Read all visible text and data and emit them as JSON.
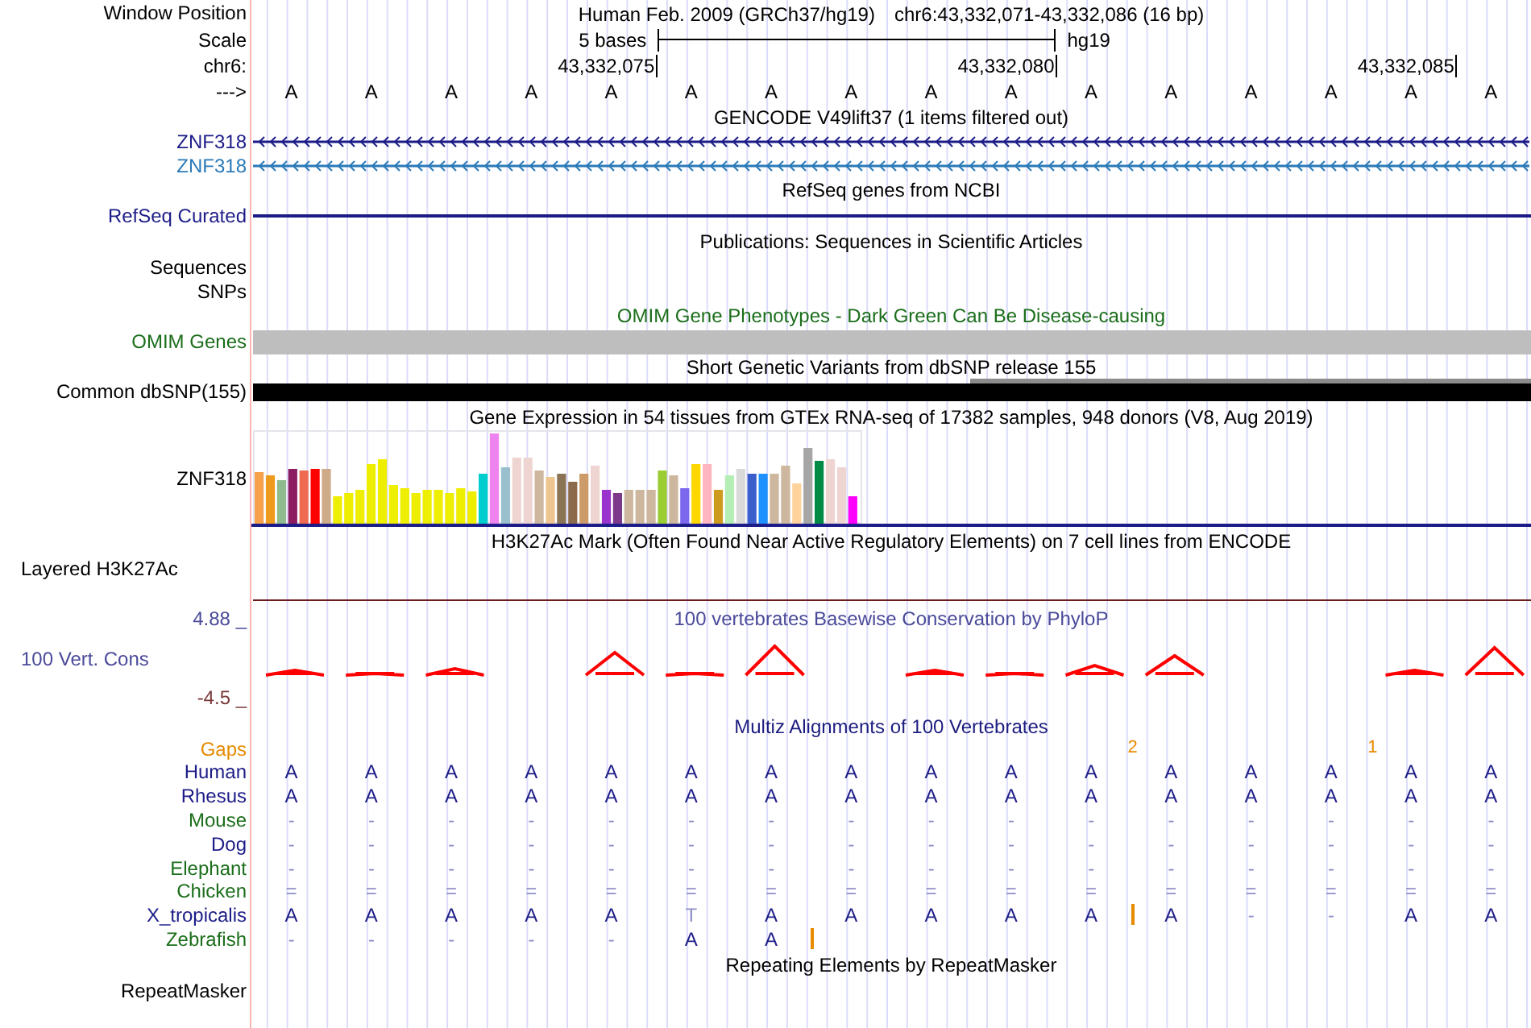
{
  "header": {
    "label": "Window Position",
    "assembly": "Human Feb. 2009 (GRCh37/hg19)",
    "position": "chr6:43,332,071-43,332,086 (16 bp)"
  },
  "scale": {
    "label": "Scale",
    "span": "5 bases",
    "assembly": "hg19"
  },
  "coordinates": {
    "label": "chr6:",
    "ticks": [
      "43,332,075",
      "43,332,080",
      "43,332,085"
    ]
  },
  "sequence": {
    "label": "--->",
    "bases": [
      "A",
      "A",
      "A",
      "A",
      "A",
      "A",
      "A",
      "A",
      "A",
      "A",
      "A",
      "A",
      "A",
      "A",
      "A",
      "A"
    ]
  },
  "tracks": [
    {
      "kind": "gene",
      "title": "GENCODE V49lift37 (1 items filtered out)",
      "rows": [
        {
          "label": "ZNF318",
          "color": "#1c1c88"
        },
        {
          "label": "ZNF318",
          "color": "#2a7ab8"
        }
      ]
    },
    {
      "kind": "line",
      "title": "RefSeq genes from NCBI",
      "label": "RefSeq Curated",
      "color": "#1c1c88"
    },
    {
      "kind": "empty",
      "title": "Publications: Sequences in Scientific Articles",
      "labels": [
        "Sequences",
        "SNPs"
      ],
      "color": "#000000"
    },
    {
      "kind": "bar",
      "title": "OMIM Gene Phenotypes - Dark Green Can Be Disease-causing",
      "label": "OMIM Genes",
      "color": "#1b6e1b"
    },
    {
      "kind": "variants",
      "title": "Short Genetic Variants from dbSNP release 155",
      "label": "Common dbSNP(155)",
      "color": "#000000"
    },
    {
      "kind": "expression",
      "title": "Gene Expression in 54 tissues from GTEx RNA-seq of 17382 samples, 948 donors (V8, Aug 2019)",
      "label": "ZNF318",
      "color": "#000000"
    },
    {
      "kind": "layered",
      "title": "H3K27Ac Mark (Often Found Near Active Regulatory Elements) on 7 cell lines from ENCODE",
      "label": "Layered H3K27Ac",
      "color": "#000000"
    },
    {
      "kind": "conservation",
      "title": "100 vertebrates Basewise Conservation by PhyloP",
      "label": "100 Vert. Cons",
      "max": "4.88 _",
      "min": "-4.5 _",
      "color": "#4a4a9a"
    },
    {
      "kind": "alignment",
      "title": "Multiz Alignments of 100 Vertebrates",
      "color": "#1c1c80",
      "gaps": {
        "label": "Gaps",
        "columns": [
          {
            "gap": false
          },
          {
            "gap": false
          },
          {
            "gap": false
          },
          {
            "gap": false
          },
          {
            "gap": false
          },
          {
            "gap": false
          },
          {
            "gap": false
          },
          {
            "gap": false
          },
          {
            "gap": false
          },
          {
            "gap": false
          },
          {
            "gap": true,
            "count": "2"
          },
          {
            "gap": false
          },
          {
            "gap": false
          },
          {
            "gap": true,
            "count": "1"
          },
          {
            "gap": false
          },
          {
            "gap": false
          }
        ]
      },
      "species": [
        {
          "label": "Human",
          "color": "#1c1c88",
          "cells": [
            {
              "text": "A",
              "match": true,
              "insertion": false
            },
            {
              "text": "A",
              "match": true,
              "insertion": false
            },
            {
              "text": "A",
              "match": true,
              "insertion": false
            },
            {
              "text": "A",
              "match": true,
              "insertion": false
            },
            {
              "text": "A",
              "match": true,
              "insertion": false
            },
            {
              "text": "A",
              "match": true,
              "insertion": false
            },
            {
              "text": "A",
              "match": true,
              "insertion": false
            },
            {
              "text": "A",
              "match": true,
              "insertion": false
            },
            {
              "text": "A",
              "match": true,
              "insertion": false
            },
            {
              "text": "A",
              "match": true,
              "insertion": false
            },
            {
              "text": "A",
              "match": true,
              "insertion": false
            },
            {
              "text": "A",
              "match": true,
              "insertion": false
            },
            {
              "text": "A",
              "match": true,
              "insertion": false
            },
            {
              "text": "A",
              "match": true,
              "insertion": false
            },
            {
              "text": "A",
              "match": true,
              "insertion": false
            },
            {
              "text": "A",
              "match": true,
              "insertion": false
            }
          ]
        },
        {
          "label": "Rhesus",
          "color": "#1c1c88",
          "cells": [
            {
              "text": "A",
              "match": true,
              "insertion": false
            },
            {
              "text": "A",
              "match": true,
              "insertion": false
            },
            {
              "text": "A",
              "match": true,
              "insertion": false
            },
            {
              "text": "A",
              "match": true,
              "insertion": false
            },
            {
              "text": "A",
              "match": true,
              "insertion": false
            },
            {
              "text": "A",
              "match": true,
              "insertion": false
            },
            {
              "text": "A",
              "match": true,
              "insertion": false
            },
            {
              "text": "A",
              "match": true,
              "insertion": false
            },
            {
              "text": "A",
              "match": true,
              "insertion": false
            },
            {
              "text": "A",
              "match": true,
              "insertion": false
            },
            {
              "text": "A",
              "match": true,
              "insertion": false
            },
            {
              "text": "A",
              "match": true,
              "insertion": false
            },
            {
              "text": "A",
              "match": true,
              "insertion": false
            },
            {
              "text": "A",
              "match": true,
              "insertion": false
            },
            {
              "text": "A",
              "match": true,
              "insertion": false
            },
            {
              "text": "A",
              "match": true,
              "insertion": false
            }
          ]
        },
        {
          "label": "Mouse",
          "color": "#1b6e1b",
          "cells": [
            {
              "text": "-",
              "match": false,
              "insertion": false
            },
            {
              "text": "-",
              "match": false,
              "insertion": false
            },
            {
              "text": "-",
              "match": false,
              "insertion": false
            },
            {
              "text": "-",
              "match": false,
              "insertion": false
            },
            {
              "text": "-",
              "match": false,
              "insertion": false
            },
            {
              "text": "-",
              "match": false,
              "insertion": false
            },
            {
              "text": "-",
              "match": false,
              "insertion": false
            },
            {
              "text": "-",
              "match": false,
              "insertion": false
            },
            {
              "text": "-",
              "match": false,
              "insertion": false
            },
            {
              "text": "-",
              "match": false,
              "insertion": false
            },
            {
              "text": "-",
              "match": false,
              "insertion": false
            },
            {
              "text": "-",
              "match": false,
              "insertion": false
            },
            {
              "text": "-",
              "match": false,
              "insertion": false
            },
            {
              "text": "-",
              "match": false,
              "insertion": false
            },
            {
              "text": "-",
              "match": false,
              "insertion": false
            },
            {
              "text": "-",
              "match": false,
              "insertion": false
            }
          ]
        },
        {
          "label": "Dog",
          "color": "#1c1c88",
          "cells": [
            {
              "text": "-",
              "match": false,
              "insertion": false
            },
            {
              "text": "-",
              "match": false,
              "insertion": false
            },
            {
              "text": "-",
              "match": false,
              "insertion": false
            },
            {
              "text": "-",
              "match": false,
              "insertion": false
            },
            {
              "text": "-",
              "match": false,
              "insertion": false
            },
            {
              "text": "-",
              "match": false,
              "insertion": false
            },
            {
              "text": "-",
              "match": false,
              "insertion": false
            },
            {
              "text": "-",
              "match": false,
              "insertion": false
            },
            {
              "text": "-",
              "match": false,
              "insertion": false
            },
            {
              "text": "-",
              "match": false,
              "insertion": false
            },
            {
              "text": "-",
              "match": false,
              "insertion": false
            },
            {
              "text": "-",
              "match": false,
              "insertion": false
            },
            {
              "text": "-",
              "match": false,
              "insertion": false
            },
            {
              "text": "-",
              "match": false,
              "insertion": false
            },
            {
              "text": "-",
              "match": false,
              "insertion": false
            },
            {
              "text": "-",
              "match": false,
              "insertion": false
            }
          ]
        },
        {
          "label": "Elephant",
          "color": "#1b6e1b",
          "cells": [
            {
              "text": "-",
              "match": false,
              "insertion": false
            },
            {
              "text": "-",
              "match": false,
              "insertion": false
            },
            {
              "text": "-",
              "match": false,
              "insertion": false
            },
            {
              "text": "-",
              "match": false,
              "insertion": false
            },
            {
              "text": "-",
              "match": false,
              "insertion": false
            },
            {
              "text": "-",
              "match": false,
              "insertion": false
            },
            {
              "text": "-",
              "match": false,
              "insertion": false
            },
            {
              "text": "-",
              "match": false,
              "insertion": false
            },
            {
              "text": "-",
              "match": false,
              "insertion": false
            },
            {
              "text": "-",
              "match": false,
              "insertion": false
            },
            {
              "text": "-",
              "match": false,
              "insertion": false
            },
            {
              "text": "-",
              "match": false,
              "insertion": false
            },
            {
              "text": "-",
              "match": false,
              "insertion": false
            },
            {
              "text": "-",
              "match": false,
              "insertion": false
            },
            {
              "text": "-",
              "match": false,
              "insertion": false
            },
            {
              "text": "-",
              "match": false,
              "insertion": false
            }
          ]
        },
        {
          "label": "Chicken",
          "color": "#1b6e1b",
          "cells": [
            {
              "text": "=",
              "match": false,
              "insertion": false
            },
            {
              "text": "=",
              "match": false,
              "insertion": false
            },
            {
              "text": "=",
              "match": false,
              "insertion": false
            },
            {
              "text": "=",
              "match": false,
              "insertion": false
            },
            {
              "text": "=",
              "match": false,
              "insertion": false
            },
            {
              "text": "=",
              "match": false,
              "insertion": false
            },
            {
              "text": "=",
              "match": false,
              "insertion": false
            },
            {
              "text": "=",
              "match": false,
              "insertion": false
            },
            {
              "text": "=",
              "match": false,
              "insertion": false
            },
            {
              "text": "=",
              "match": false,
              "insertion": false
            },
            {
              "text": "=",
              "match": false,
              "insertion": false
            },
            {
              "text": "=",
              "match": false,
              "insertion": false
            },
            {
              "text": "=",
              "match": false,
              "insertion": false
            },
            {
              "text": "=",
              "match": false,
              "insertion": false
            },
            {
              "text": "=",
              "match": false,
              "insertion": false
            },
            {
              "text": "=",
              "match": false,
              "insertion": false
            }
          ]
        },
        {
          "label": "X_tropicalis",
          "color": "#1c1c88",
          "cells": [
            {
              "text": "A",
              "match": true,
              "insertion": false
            },
            {
              "text": "A",
              "match": true,
              "insertion": false
            },
            {
              "text": "A",
              "match": true,
              "insertion": false
            },
            {
              "text": "A",
              "match": true,
              "insertion": false
            },
            {
              "text": "A",
              "match": true,
              "insertion": false
            },
            {
              "text": "T",
              "match": false,
              "insertion": false
            },
            {
              "text": "A",
              "match": true,
              "insertion": false
            },
            {
              "text": "A",
              "match": true,
              "insertion": false
            },
            {
              "text": "A",
              "match": true,
              "insertion": false
            },
            {
              "text": "A",
              "match": true,
              "insertion": false
            },
            {
              "text": "A",
              "match": true,
              "insertion": true
            },
            {
              "text": "A",
              "match": true,
              "insertion": false
            },
            {
              "text": "-",
              "match": false,
              "insertion": false
            },
            {
              "text": "-",
              "match": false,
              "insertion": false
            },
            {
              "text": "A",
              "match": true,
              "insertion": false
            },
            {
              "text": "A",
              "match": true,
              "insertion": false
            }
          ]
        },
        {
          "label": "Zebrafish",
          "color": "#1b6e1b",
          "cells": [
            {
              "text": "-",
              "match": false,
              "insertion": false
            },
            {
              "text": "-",
              "match": false,
              "insertion": false
            },
            {
              "text": "-",
              "match": false,
              "insertion": false
            },
            {
              "text": "-",
              "match": false,
              "insertion": false
            },
            {
              "text": "-",
              "match": false,
              "insertion": false
            },
            {
              "text": "A",
              "match": true,
              "insertion": false
            },
            {
              "text": "A",
              "match": true,
              "insertion": true
            }
          ]
        }
      ]
    },
    {
      "kind": "empty",
      "title": "Repeating Elements by RepeatMasker",
      "labels": [
        "RepeatMasker"
      ],
      "color": "#000000"
    }
  ]
}
